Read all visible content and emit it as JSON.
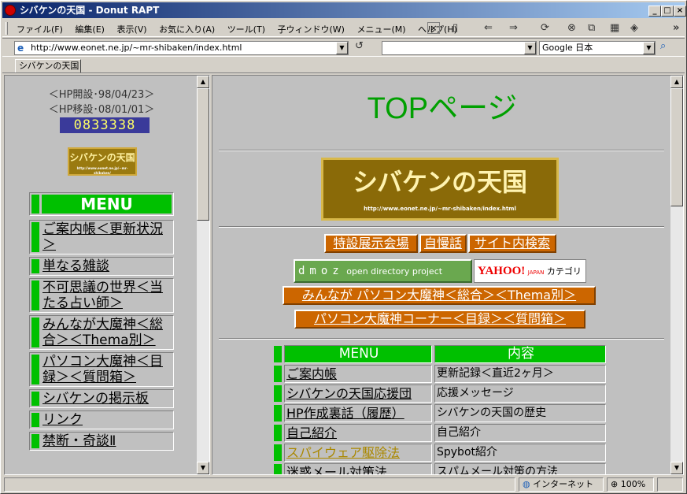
{
  "window": {
    "title": "シバケンの天国 - Donut RAPT"
  },
  "titlebar_buttons": {
    "minimize": "_",
    "maximize": "□",
    "close": "×"
  },
  "menubar": {
    "items": [
      "ファイル(F)",
      "編集(E)",
      "表示(V)",
      "お気に入り(A)",
      "ツール(T)",
      "子ウィンドウ(W)",
      "メニュー(M)",
      "ヘルプ(H)"
    ],
    "close_box": "×",
    "overflow": "»"
  },
  "addressbar": {
    "url": "http://www.eonet.ne.jp/~mr-shibaken/index.html",
    "search_engine": "Google 日本"
  },
  "tabs": [
    {
      "label": "シバケンの天国"
    }
  ],
  "left": {
    "hp_open": "＜HP開設･98/04/23＞",
    "hp_move": "＜HP移設･08/01/01＞",
    "counter": "0833338",
    "logo_text": "シバケンの天国",
    "logo_url": "http://www.eonet.ne.jp/~mr-shibaken/",
    "menu_title": "MENU",
    "menu_items": [
      {
        "label": "ご案内帳＜更新状況＞"
      },
      {
        "label": "単なる雑談"
      },
      {
        "label": "不可思議の世界＜当たる占い師＞"
      },
      {
        "label": "みんなが大魔神＜総合＞＜Thema別＞"
      },
      {
        "label": "パソコン大魔神＜目録＞＜質問箱＞"
      },
      {
        "label": "シバケンの掲示板"
      },
      {
        "label": "リンク"
      },
      {
        "label": "禁断・奇談Ⅱ"
      }
    ]
  },
  "main": {
    "title": "TOPページ",
    "banner_text": "シバケンの天国",
    "banner_url": "http://www.eonet.ne.jp/~mr-shibaken/index.html",
    "links_row1": [
      "特設展示会場",
      "自慢話",
      "サイト内検索"
    ],
    "dmoz_letters": "dmoz",
    "dmoz_text": "open directory project",
    "yahoo_logo": "YAHOO!",
    "yahoo_sub": "JAPAN",
    "yahoo_text": "カテゴリ",
    "link_row2": "みんなが パソコン大魔神＜総合＞＜Thema別＞",
    "link_row3": "パソコン大魔神コーナー＜目録＞＜質問箱＞",
    "table": {
      "headers": [
        "MENU",
        "内容"
      ],
      "rows": [
        {
          "menu": "ご案内帳",
          "desc": "更新記録＜直近2ヶ月＞"
        },
        {
          "menu": "シバケンの天国応援団",
          "desc": "応援メッセージ"
        },
        {
          "menu": "HP作成裏話（履歴）",
          "desc": "シバケンの天国の歴史"
        },
        {
          "menu": "自己紹介",
          "desc": "自己紹介"
        },
        {
          "menu": "スパイウェア駆除法",
          "desc": "Spybot紹介"
        },
        {
          "menu": "迷惑メール対策法",
          "desc": "スパムメール対策の方法"
        }
      ]
    }
  },
  "statusbar": {
    "zone": "インターネット",
    "zoom": "100%"
  }
}
